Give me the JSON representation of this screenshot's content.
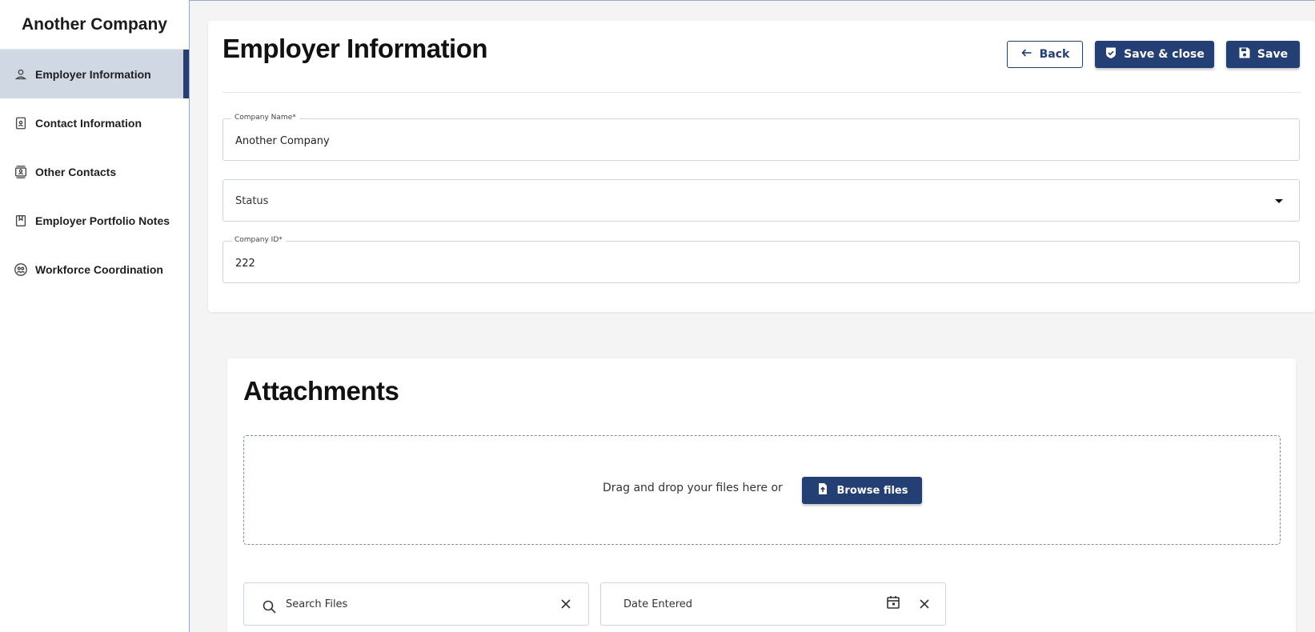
{
  "sidebar": {
    "title": "Another Company",
    "items": [
      {
        "label": "Employer Information",
        "icon": "person-icon",
        "active": true
      },
      {
        "label": "Contact Information",
        "icon": "contact-card-icon",
        "active": false
      },
      {
        "label": "Other Contacts",
        "icon": "contacts-book-icon",
        "active": false
      },
      {
        "label": "Employer Portfolio Notes",
        "icon": "notes-icon",
        "active": false
      },
      {
        "label": "Workforce Coordination",
        "icon": "people-group-icon",
        "active": false
      }
    ]
  },
  "header": {
    "title": "Employer Information",
    "back_label": "Back",
    "save_close_label": "Save & close",
    "save_label": "Save"
  },
  "form": {
    "company_name": {
      "label": "Company Name*",
      "value": "Another Company"
    },
    "status": {
      "placeholder": "Status"
    },
    "company_id": {
      "label": "Company ID*",
      "value": "222"
    }
  },
  "attachments": {
    "title": "Attachments",
    "drop_text": "Drag and drop your files here or",
    "browse_label": "Browse files",
    "search_placeholder": "Search Files",
    "date_placeholder": "Date Entered"
  },
  "colors": {
    "primary": "#243f73",
    "active_nav_bg": "#d0d8e4",
    "page_bg": "#f4f4f4"
  }
}
